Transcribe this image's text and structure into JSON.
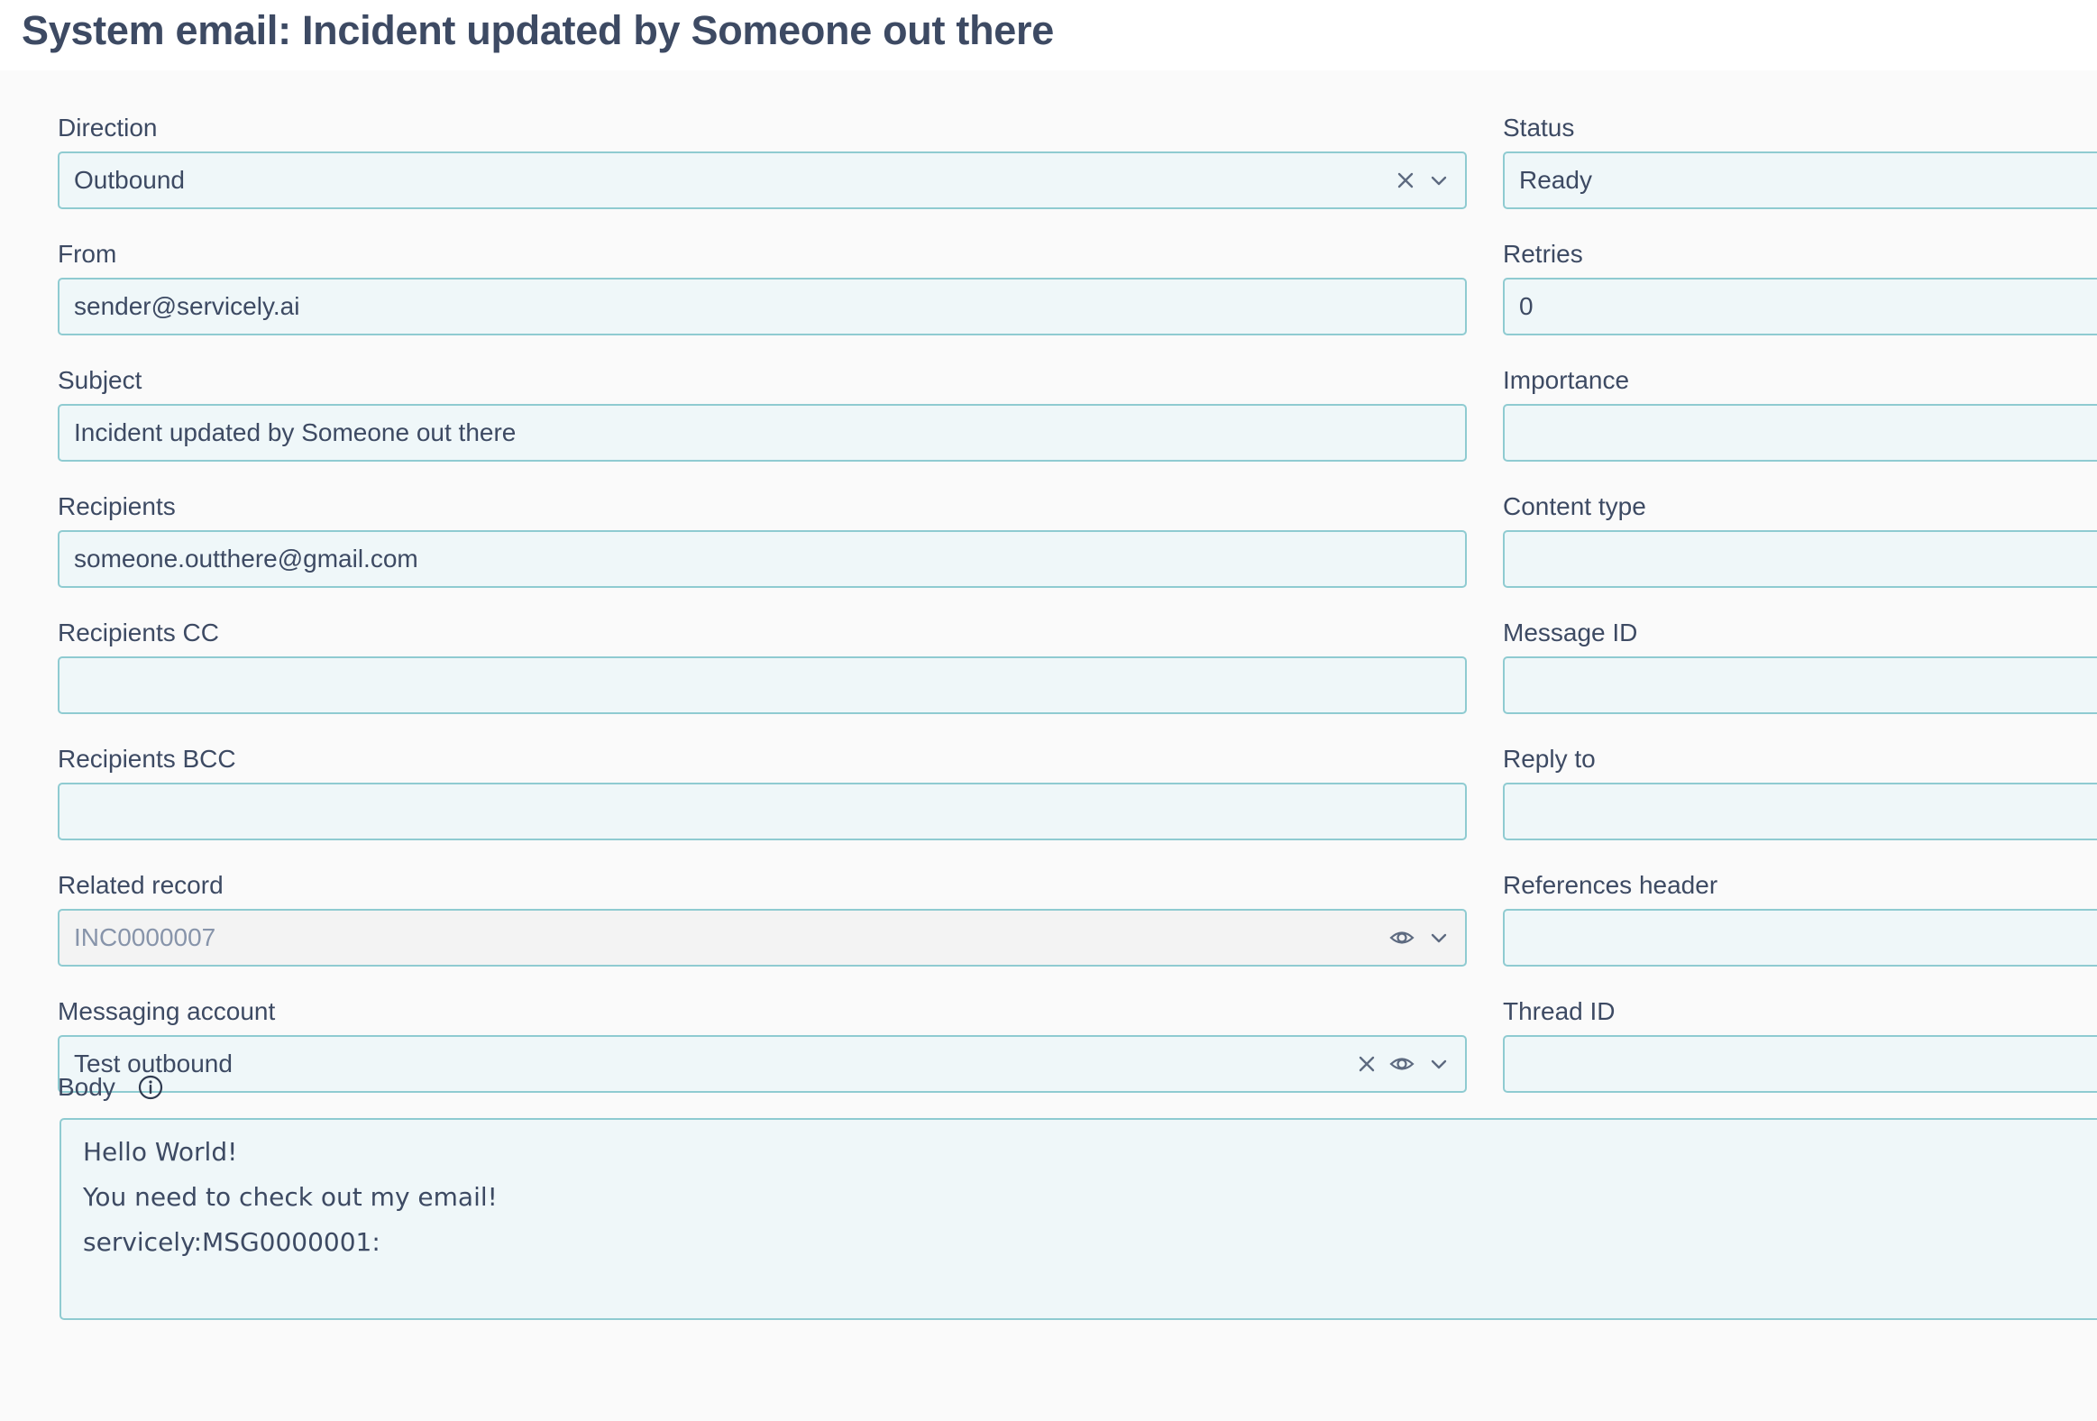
{
  "page": {
    "title": "System email: Incident updated by Someone out there"
  },
  "left_fields": [
    {
      "label": "Direction",
      "value": "Outbound",
      "icons": [
        "clear-icon",
        "chevron-down-icon"
      ]
    },
    {
      "label": "From",
      "value": "sender@servicely.ai"
    },
    {
      "label": "Subject",
      "value": "Incident updated by Someone out there"
    },
    {
      "label": "Recipients",
      "value": "someone.outthere@gmail.com"
    },
    {
      "label": "Recipients CC",
      "value": ""
    },
    {
      "label": "Recipients BCC",
      "value": ""
    },
    {
      "label": "Related record",
      "value": "INC0000007",
      "disabled": true,
      "icons": [
        "eye-icon",
        "chevron-down-icon"
      ]
    },
    {
      "label": "Messaging account",
      "value": "Test outbound",
      "icons": [
        "clear-icon",
        "eye-icon",
        "chevron-down-icon"
      ]
    }
  ],
  "right_fields": [
    {
      "label": "Status",
      "value": "Ready"
    },
    {
      "label": "Retries",
      "value": "0"
    },
    {
      "label": "Importance",
      "value": ""
    },
    {
      "label": "Content type",
      "value": ""
    },
    {
      "label": "Message ID",
      "value": ""
    },
    {
      "label": "Reply to",
      "value": ""
    },
    {
      "label": "References header",
      "value": ""
    },
    {
      "label": "Thread ID",
      "value": ""
    }
  ],
  "body": {
    "label": "Body",
    "icon": "info-icon",
    "lines": [
      "Hello World!",
      "You need to check out my email!",
      "servicely:MSG0000001:"
    ]
  },
  "colors": {
    "field_background": "#eff7f9",
    "field_border": "#8fcbd1",
    "disabled_background": "#f3f3f3",
    "text": "#3d4a63",
    "muted_text": "#8794aa"
  }
}
